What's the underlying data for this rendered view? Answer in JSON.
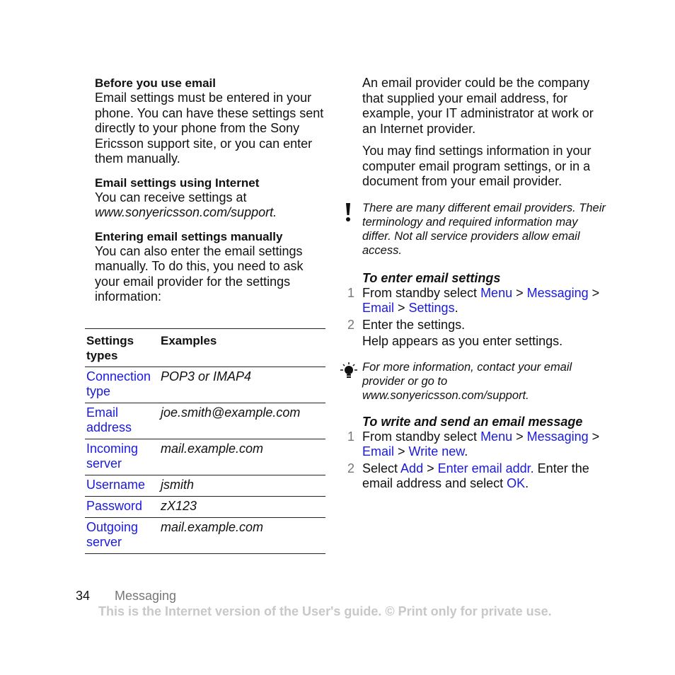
{
  "left": {
    "section1": {
      "heading": "Before you use email",
      "body": "Email settings must be entered in your phone. You can have these settings sent directly to your phone from the Sony Ericsson support site, or you can enter them manually."
    },
    "section2": {
      "heading": "Email settings using Internet",
      "body": "You can receive settings at",
      "link": "www.sonyericsson.com/support."
    },
    "section3": {
      "heading": "Entering email settings manually",
      "body": "You can also enter the email settings manually. To do this, you need to ask your email provider for the settings information:"
    }
  },
  "table": {
    "headers": [
      "Settings types",
      "Examples"
    ],
    "rows": [
      {
        "type": "Connection type",
        "example": "POP3 or IMAP4"
      },
      {
        "type": "Email address",
        "example": "joe.smith@example.com"
      },
      {
        "type": "Incoming server",
        "example": "mail.example.com"
      },
      {
        "type": "Username",
        "example": "jsmith"
      },
      {
        "type": "Password",
        "example": "zX123"
      },
      {
        "type": "Outgoing server",
        "example": "mail.example.com"
      }
    ]
  },
  "right": {
    "para1": "An email provider could be the company that supplied your email address, for example, your IT administrator at work or an Internet provider.",
    "para2": "You may find settings information in your computer email program settings, or in a document from your email provider.",
    "warning": {
      "icon": "exclamation-icon",
      "text": "There are many different email providers. Their terminology and required information may differ. Not all service providers allow email access."
    },
    "proc1": {
      "title": "To enter email settings",
      "steps": [
        {
          "num": "1",
          "pre": "From standby select ",
          "items": [
            "Menu",
            "Messaging",
            "Email",
            "Settings"
          ],
          "post": "."
        },
        {
          "num": "2",
          "text": "Enter the settings.",
          "extra": "Help appears as you enter settings."
        }
      ]
    },
    "tip": {
      "icon": "lightbulb-icon",
      "text": "For more information, contact your email provider or go to www.sonyericsson.com/support."
    },
    "proc2": {
      "title": "To write and send an email message",
      "steps": [
        {
          "num": "1",
          "pre": "From standby select ",
          "items": [
            "Menu",
            "Messaging",
            "Email",
            "Write new"
          ],
          "post": "."
        },
        {
          "num": "2",
          "pre": "Select ",
          "items": [
            "Add",
            "Enter email addr."
          ],
          "mid": " Enter the email address and select ",
          "ok": "OK",
          "post": "."
        }
      ]
    }
  },
  "footer": {
    "page_number": "34",
    "section": "Messaging",
    "notice": "This is the Internet version of the User's guide. © Print only for private use."
  },
  "colors": {
    "link": "#1a1adc",
    "step_number": "#777777",
    "footer_notice": "#c8c8c8"
  }
}
